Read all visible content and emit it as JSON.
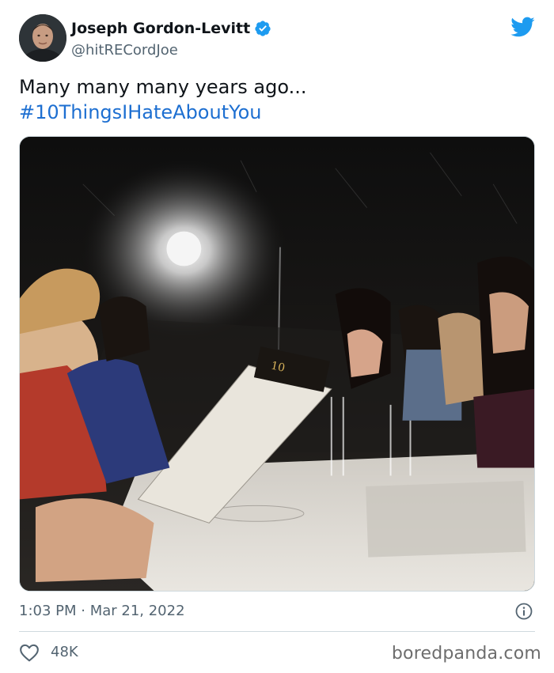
{
  "tweet": {
    "author": {
      "display_name": "Joseph Gordon-Levitt",
      "handle": "@hitRECordJoe",
      "verified": true
    },
    "text_line1": "Many many many years ago...",
    "hashtag": "#10ThingsIHateAboutYou",
    "timestamp": "1:03 PM · Mar 21, 2022",
    "likes": "48K"
  },
  "watermark": "boredpanda.com",
  "colors": {
    "text": "#0f1419",
    "secondary": "#536471",
    "link": "#1d6fd1",
    "twitter_blue": "#1d9bf0",
    "divider": "#cfd9de"
  },
  "icons": {
    "verified": "verified-badge-icon",
    "twitter": "twitter-bird-icon",
    "info": "info-icon",
    "like": "heart-icon"
  }
}
